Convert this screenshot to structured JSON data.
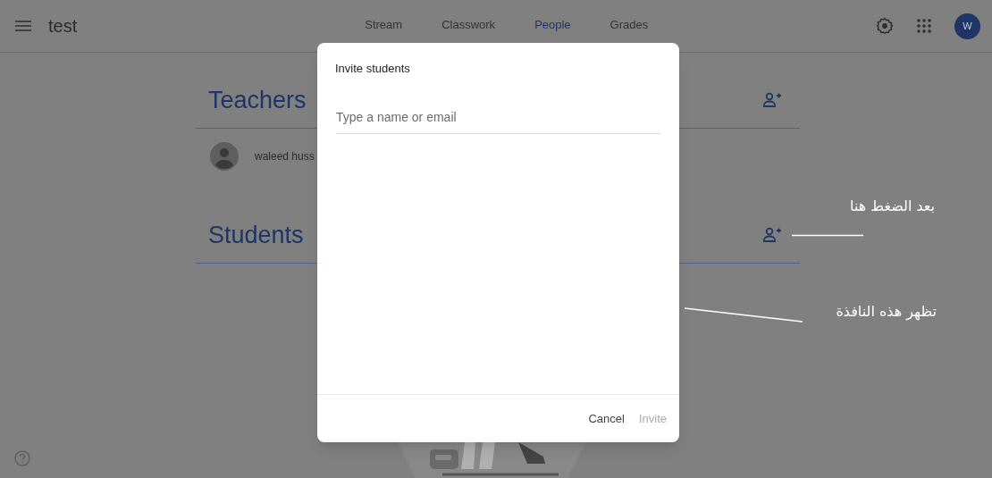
{
  "header": {
    "title": "test",
    "avatar_initial": "W"
  },
  "tabs": [
    {
      "label": "Stream",
      "selected": false
    },
    {
      "label": "Classwork",
      "selected": false
    },
    {
      "label": "People",
      "selected": true
    },
    {
      "label": "Grades",
      "selected": false
    }
  ],
  "sections": [
    {
      "title": "Teachers",
      "people": [
        {
          "name": "waleed huss"
        }
      ]
    },
    {
      "title": "Students"
    }
  ],
  "dialog": {
    "title": "Invite students",
    "field": {
      "placeholder": "Type a name or email"
    },
    "buttons": [
      {
        "label": "Cancel",
        "disabled": false
      },
      {
        "label": "Invite",
        "disabled": true
      }
    ]
  },
  "annotations": [
    {
      "text": "بعد الضغط هنا"
    },
    {
      "text": "تظهر هذه النافذة"
    }
  ]
}
